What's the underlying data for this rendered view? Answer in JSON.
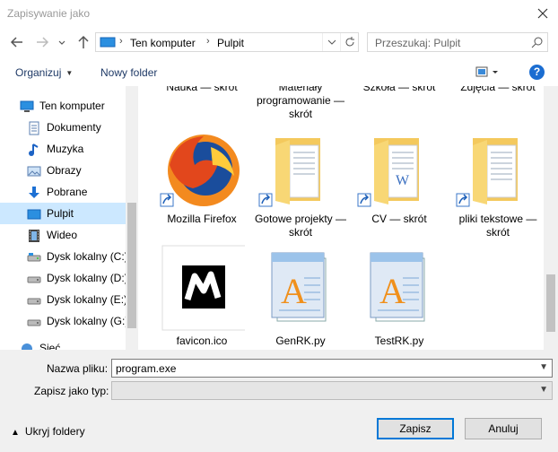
{
  "window": {
    "title": "Zapisywanie jako"
  },
  "address": {
    "crumbs": [
      "Ten komputer",
      "Pulpit"
    ]
  },
  "search": {
    "placeholder": "Przeszukaj: Pulpit"
  },
  "toolbar": {
    "organize": "Organizuj",
    "new_folder": "Nowy folder"
  },
  "sidebar": {
    "items": [
      {
        "label": "Ten komputer",
        "icon": "computer-icon"
      },
      {
        "label": "Dokumenty",
        "icon": "documents-icon"
      },
      {
        "label": "Muzyka",
        "icon": "music-icon"
      },
      {
        "label": "Obrazy",
        "icon": "pictures-icon"
      },
      {
        "label": "Pobrane",
        "icon": "downloads-icon"
      },
      {
        "label": "Pulpit",
        "icon": "desktop-icon",
        "selected": true
      },
      {
        "label": "Wideo",
        "icon": "video-icon"
      },
      {
        "label": "Dysk lokalny (C:)",
        "icon": "drive-icon"
      },
      {
        "label": "Dysk lokalny (D:)",
        "icon": "drive-icon"
      },
      {
        "label": "Dysk lokalny (E:)",
        "icon": "drive-icon"
      },
      {
        "label": "Dysk lokalny (G:)",
        "icon": "drive-icon"
      },
      {
        "label": "Sieć",
        "icon": "network-icon"
      }
    ]
  },
  "files": {
    "top_partial": [
      "Nauka — skrót",
      "Materiały programowanie — skrót",
      "Szkoła — skrót",
      "Zdjęcia — skrót"
    ],
    "row1": [
      "Mozilla Firefox",
      "Gotowe projekty — skrót",
      "CV — skrót",
      "pliki tekstowe — skrót"
    ],
    "row2": [
      "favicon.ico",
      "GenRK.py",
      "TestRK.py"
    ]
  },
  "footer": {
    "filename_label": "Nazwa pliku:",
    "filename_value": "program.exe",
    "filetype_label": "Zapisz jako typ:",
    "filetype_value": "",
    "hide_folders": "Ukryj foldery",
    "save": "Zapisz",
    "cancel": "Anuluj"
  },
  "colors": {
    "selection": "#cce8ff",
    "accent": "#0078d7",
    "folder": "#f8d775"
  }
}
